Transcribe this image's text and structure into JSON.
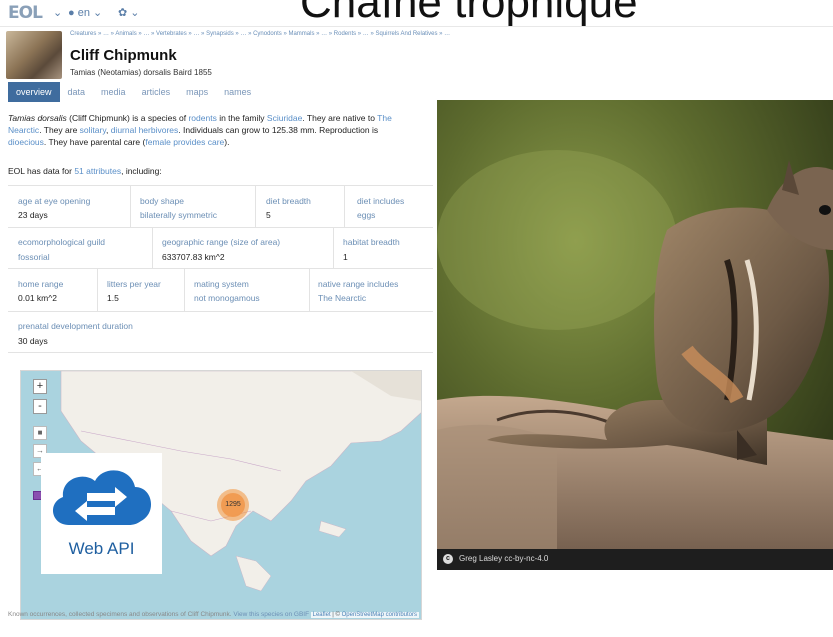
{
  "nav": {
    "brand": "EOL",
    "language": "en",
    "overlay_title": "Chaîne trophique"
  },
  "header": {
    "breadcrumb": "Creatures » … » Animals » … » Vertebrates » … » Synapsids » … » Cynodonts » Mammals » … » Rodents » … » Squirrels And Relatives » …",
    "title": "Cliff Chipmunk",
    "scientific_name": "Tamias (Neotamias) dorsalis Baird 1855"
  },
  "tabs": [
    "overview",
    "data",
    "media",
    "articles",
    "maps",
    "names"
  ],
  "description": {
    "p1_a": "Tamias dorsalis",
    "p1_b": " (Cliff Chipmunk) is a species of ",
    "p1_link1": "rodents",
    "p1_c": " in the family ",
    "p1_link2": "Sciuridae",
    "p1_d": ". They are native to ",
    "p1_link3": "The Nearctic",
    "p1_e": ". They are ",
    "p1_link4": "solitary",
    "p1_f": ", ",
    "p1_link5": "diurnal herbivores",
    "p1_g": ". Individuals can grow to 125.38 mm. Reproduction is ",
    "p1_link6": "dioecious",
    "p1_h": ". They have parental care (",
    "p1_link7": "female provides care",
    "p1_i": ").",
    "attr_intro_a": "EOL has data for ",
    "attr_intro_link": "51 attributes",
    "attr_intro_b": ", including:"
  },
  "attributes": [
    {
      "label": "age at eye opening",
      "value": "23 days"
    },
    {
      "label": "body shape",
      "value": "bilaterally symmetric"
    },
    {
      "label": "diet breadth",
      "value": "5"
    },
    {
      "label": "diet includes",
      "value": "eggs"
    },
    {
      "label": "ecomorphological guild",
      "value": "fossorial"
    },
    {
      "label": "geographic range (size of area)",
      "value": "633707.83 km^2"
    },
    {
      "label": "habitat breadth",
      "value": "1"
    },
    {
      "label": "home range",
      "value": "0.01 km^2"
    },
    {
      "label": "litters per year",
      "value": "1.5"
    },
    {
      "label": "mating system",
      "value": "not monogamous"
    },
    {
      "label": "native range includes",
      "value": "The Nearctic"
    },
    {
      "label": "prenatal development duration",
      "value": "30 days"
    }
  ],
  "map": {
    "zoom_in": "+",
    "zoom_out": "-",
    "cluster_count": "1295",
    "attribution_a": "Leaflet",
    "attribution_b": " | © ",
    "attribution_c": "OpenStreetMap contributors",
    "caption_a": "Known occurrences, collected specimens and observations of Cliff Chipmunk. ",
    "caption_link": "View this species on GBIF",
    "webapi_label": "Web API"
  },
  "photo": {
    "credit": "Greg Lasley   cc-by-nc-4.0"
  },
  "colors": {
    "accent": "#3f6c9e",
    "link": "#5a8fc8",
    "cluster": "#f09a50"
  }
}
